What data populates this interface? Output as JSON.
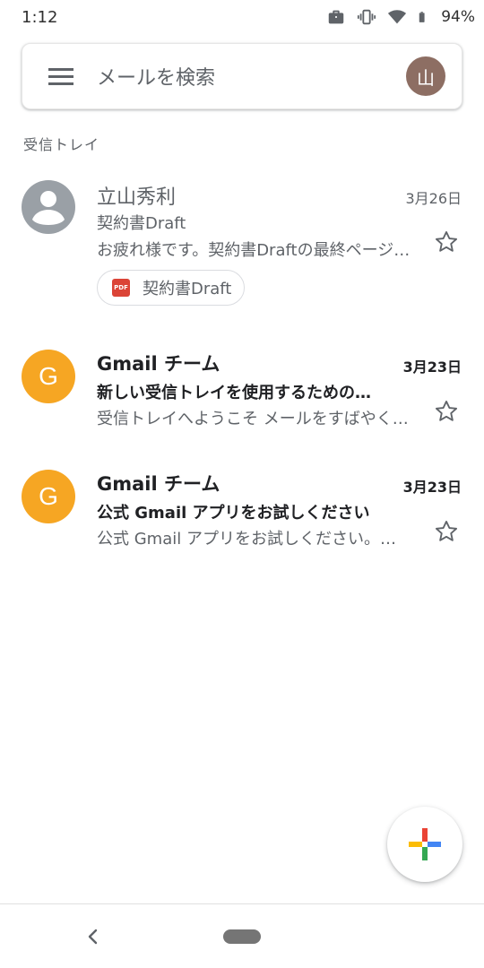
{
  "status_bar": {
    "time": "1:12",
    "battery_percent": "94%",
    "icons": [
      "briefcase-icon",
      "vibrate-icon",
      "wifi-icon",
      "battery-icon"
    ]
  },
  "search": {
    "placeholder": "メールを検索",
    "account_initial": "山",
    "account_color": "#8d6e63"
  },
  "section_label": "受信トレイ",
  "emails": [
    {
      "sender": "立山秀利",
      "date": "3月26日",
      "subject": "契約書Draft",
      "snippet": "お疲れ様です。契約書Draftの最終ページの…",
      "unread": false,
      "starred": false,
      "avatar_color": "#9aa0a6",
      "attachment": {
        "type": "PDF",
        "name": "契約書Draft"
      }
    },
    {
      "sender": "Gmail チーム",
      "date": "3月23日",
      "subject": "新しい受信トレイを使用するための…",
      "snippet": "受信トレイへようこそ メールをすばやく…",
      "unread": true,
      "starred": false,
      "avatar_letter": "G",
      "avatar_color": "#f6a623"
    },
    {
      "sender": "Gmail チーム",
      "date": "3月23日",
      "subject": "公式 Gmail アプリをお試しください",
      "snippet": "公式 Gmail アプリをお試しください。…",
      "unread": true,
      "starred": false,
      "avatar_letter": "G",
      "avatar_color": "#f6a623"
    }
  ],
  "fab": {
    "icon": "compose-plus-icon",
    "colors": [
      "#ea4335",
      "#4285f4",
      "#34a853",
      "#fbbc05"
    ]
  },
  "nav": {
    "icons": [
      "back-icon",
      "home-pill"
    ]
  }
}
